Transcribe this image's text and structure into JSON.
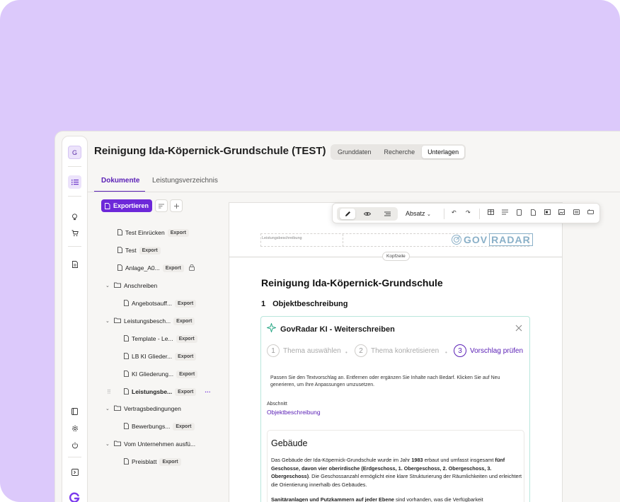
{
  "app": {
    "title": "Reinigung Ida-Köpernick-Grundschule (TEST)",
    "avatar": "G",
    "segments": [
      {
        "label": "Grunddaten",
        "active": false
      },
      {
        "label": "Recherche",
        "active": false
      },
      {
        "label": "Unterlagen",
        "active": true
      }
    ],
    "tabs": [
      {
        "label": "Dokumente",
        "active": true
      },
      {
        "label": "Leistungsverzeichnis",
        "active": false
      }
    ]
  },
  "sidebar": {
    "export_label": "Exportieren",
    "tree": [
      {
        "label": "Test Einrücken",
        "badge": "Export",
        "type": "file"
      },
      {
        "label": "Test",
        "badge": "Export",
        "type": "file"
      },
      {
        "label": "Anlage_A0...",
        "badge": "Export",
        "type": "file",
        "locked": true
      },
      {
        "label": "Anschreiben",
        "badge": "",
        "type": "folder"
      },
      {
        "label": "Angebotsauff...",
        "badge": "Export",
        "type": "file"
      },
      {
        "label": "Leistungsbesch...",
        "badge": "Export",
        "type": "folder"
      },
      {
        "label": "Template - Le...",
        "badge": "Export",
        "type": "file"
      },
      {
        "label": "LB KI Glieder...",
        "badge": "Export",
        "type": "file"
      },
      {
        "label": "KI Gliederung...",
        "badge": "Export",
        "type": "file"
      },
      {
        "label": "Leistungsbe...",
        "badge": "Export",
        "type": "file",
        "selected": true
      },
      {
        "label": "Vertragsbedingungen",
        "badge": "",
        "type": "folder"
      },
      {
        "label": "Bewerbungs...",
        "badge": "Export",
        "type": "file"
      },
      {
        "label": "Vom Unternehmen ausfü...",
        "badge": "",
        "type": "folder"
      },
      {
        "label": "Preisblatt",
        "badge": "Export",
        "type": "file"
      }
    ]
  },
  "toolbar": {
    "paragraph_style": "Absatz"
  },
  "editor": {
    "header_label": "Leistungsbeschreibung",
    "brand_left": "GOV",
    "brand_right": "RADAR",
    "header_chip": "Kopfzeile",
    "doc_title": "Reinigung Ida-Köpernick-Grundschule",
    "section_num": "1",
    "section_title": "Objektbeschreibung"
  },
  "ai_panel": {
    "title": "GovRadar KI - Weiterschreiben",
    "steps": [
      {
        "num": "1",
        "label": "Thema auswählen",
        "active": false
      },
      {
        "num": "2",
        "label": "Thema konkretisieren",
        "active": false
      },
      {
        "num": "3",
        "label": "Vorschlag prüfen",
        "active": true
      }
    ],
    "intro": "Passen Sie den Textvorschlag an. Entfernen oder ergänzen Sie Inhalte nach Bedarf. Klicken Sie auf Neu generieren, um Ihre Anpassungen umzusetzen.",
    "section_label": "Abschnitt",
    "section_value": "Objektbeschreibung",
    "card_heading": "Gebäude",
    "card_p1_a": "Das Gebäude der Ida-Köpernick-Grundschule wurde im Jahr ",
    "card_p1_year": "1983",
    "card_p1_b": " erbaut und umfasst insgesamt ",
    "card_p1_bold": "fünf Geschosse, davon vier oberirdische (Erdgeschoss, 1. Obergeschoss, 2. Obergeschoss, 3. Obergeschoss)",
    "card_p1_c": ". Die Geschossanzahl ermöglicht eine klare Strukturierung der Räumlichkeiten und erleichtert die Orientierung innerhalb des Gebäudes.",
    "card_p2_bold": "Sanitäranlagen und Putzkammern auf jeder Ebene",
    "card_p2_rest": " sind vorhanden, was die Verfügbarkeit"
  }
}
